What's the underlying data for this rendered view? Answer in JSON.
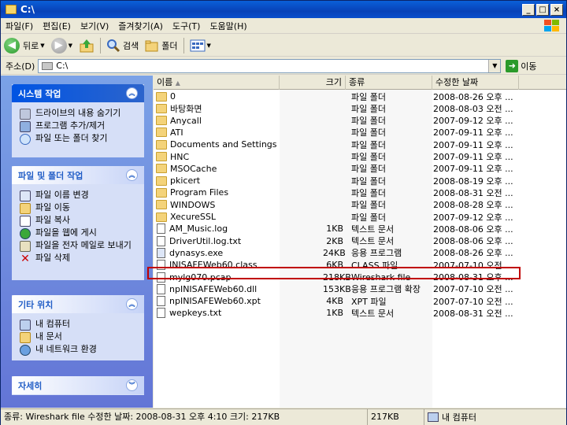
{
  "window": {
    "title": "C:\\"
  },
  "menu": [
    "파일(F)",
    "편집(E)",
    "보기(V)",
    "즐겨찾기(A)",
    "도구(T)",
    "도움말(H)"
  ],
  "toolbar": {
    "back": "뒤로",
    "search": "검색",
    "folders": "폴더"
  },
  "address": {
    "label": "주소(D)",
    "value": "C:\\",
    "go": "이동"
  },
  "panels": {
    "system": {
      "title": "시스템 작업",
      "items": [
        "드라이브의 내용 숨기기",
        "프로그램 추가/제거",
        "파일 또는 폴더 찾기"
      ]
    },
    "filefolder": {
      "title": "파일 및 폴더 작업",
      "items": [
        "파일 이름 변경",
        "파일 이동",
        "파일 복사",
        "파일을 웹에 게시",
        "파일을 전자 메일로 보내기",
        "파일 삭제"
      ]
    },
    "other": {
      "title": "기타 위치",
      "items": [
        "내 컴퓨터",
        "내 문서",
        "내 네트워크 환경"
      ]
    },
    "details": {
      "title": "자세히"
    }
  },
  "columns": {
    "name": "이름",
    "size": "크기",
    "type": "종류",
    "date": "수정한 날짜"
  },
  "files": [
    {
      "name": "0",
      "size": "",
      "type": "파일 폴더",
      "date": "2008-08-26 오후 ..."
    },
    {
      "name": "바탕화면",
      "size": "",
      "type": "파일 폴더",
      "date": "2008-08-03 오전 ..."
    },
    {
      "name": "Anycall",
      "size": "",
      "type": "파일 폴더",
      "date": "2007-09-12 오후 ..."
    },
    {
      "name": "ATI",
      "size": "",
      "type": "파일 폴더",
      "date": "2007-09-11 오후 ..."
    },
    {
      "name": "Documents and Settings",
      "size": "",
      "type": "파일 폴더",
      "date": "2007-09-11 오후 ..."
    },
    {
      "name": "HNC",
      "size": "",
      "type": "파일 폴더",
      "date": "2007-09-11 오후 ..."
    },
    {
      "name": "MSOCache",
      "size": "",
      "type": "파일 폴더",
      "date": "2007-09-11 오후 ..."
    },
    {
      "name": "pkicert",
      "size": "",
      "type": "파일 폴더",
      "date": "2008-08-19 오후 ..."
    },
    {
      "name": "Program Files",
      "size": "",
      "type": "파일 폴더",
      "date": "2008-08-31 오전 ..."
    },
    {
      "name": "WINDOWS",
      "size": "",
      "type": "파일 폴더",
      "date": "2008-08-28 오후 ..."
    },
    {
      "name": "XecureSSL",
      "size": "",
      "type": "파일 폴더",
      "date": "2007-09-12 오후 ..."
    },
    {
      "name": "AM_Music.log",
      "size": "1KB",
      "type": "텍스트 문서",
      "date": "2008-08-06 오후 ..."
    },
    {
      "name": "DriverUtil.log.txt",
      "size": "2KB",
      "type": "텍스트 문서",
      "date": "2008-08-06 오후 ..."
    },
    {
      "name": "dynasys.exe",
      "size": "24KB",
      "type": "응용 프로그램",
      "date": "2008-08-26 오후 ..."
    },
    {
      "name": "INISAFEWeb60.class",
      "size": "6KB",
      "type": "CLASS 파일",
      "date": "2007-07-10 오전 ..."
    },
    {
      "name": "mylg070.pcap",
      "size": "218KB",
      "type": "Wireshark file",
      "date": "2008-08-31 오후 ..."
    },
    {
      "name": "npINISAFEWeb60.dll",
      "size": "153KB",
      "type": "응용 프로그램 확장",
      "date": "2007-07-10 오전 ..."
    },
    {
      "name": "npINISAFEWeb60.xpt",
      "size": "4KB",
      "type": "XPT 파일",
      "date": "2007-07-10 오전 ..."
    },
    {
      "name": "wepkeys.txt",
      "size": "1KB",
      "type": "텍스트 문서",
      "date": "2008-08-31 오전 ..."
    }
  ],
  "status": {
    "main": "종류: Wireshark file 수정한 날짜: 2008-08-31 오후 4:10 크기: 217KB",
    "size": "217KB",
    "location": "내 컴퓨터"
  }
}
